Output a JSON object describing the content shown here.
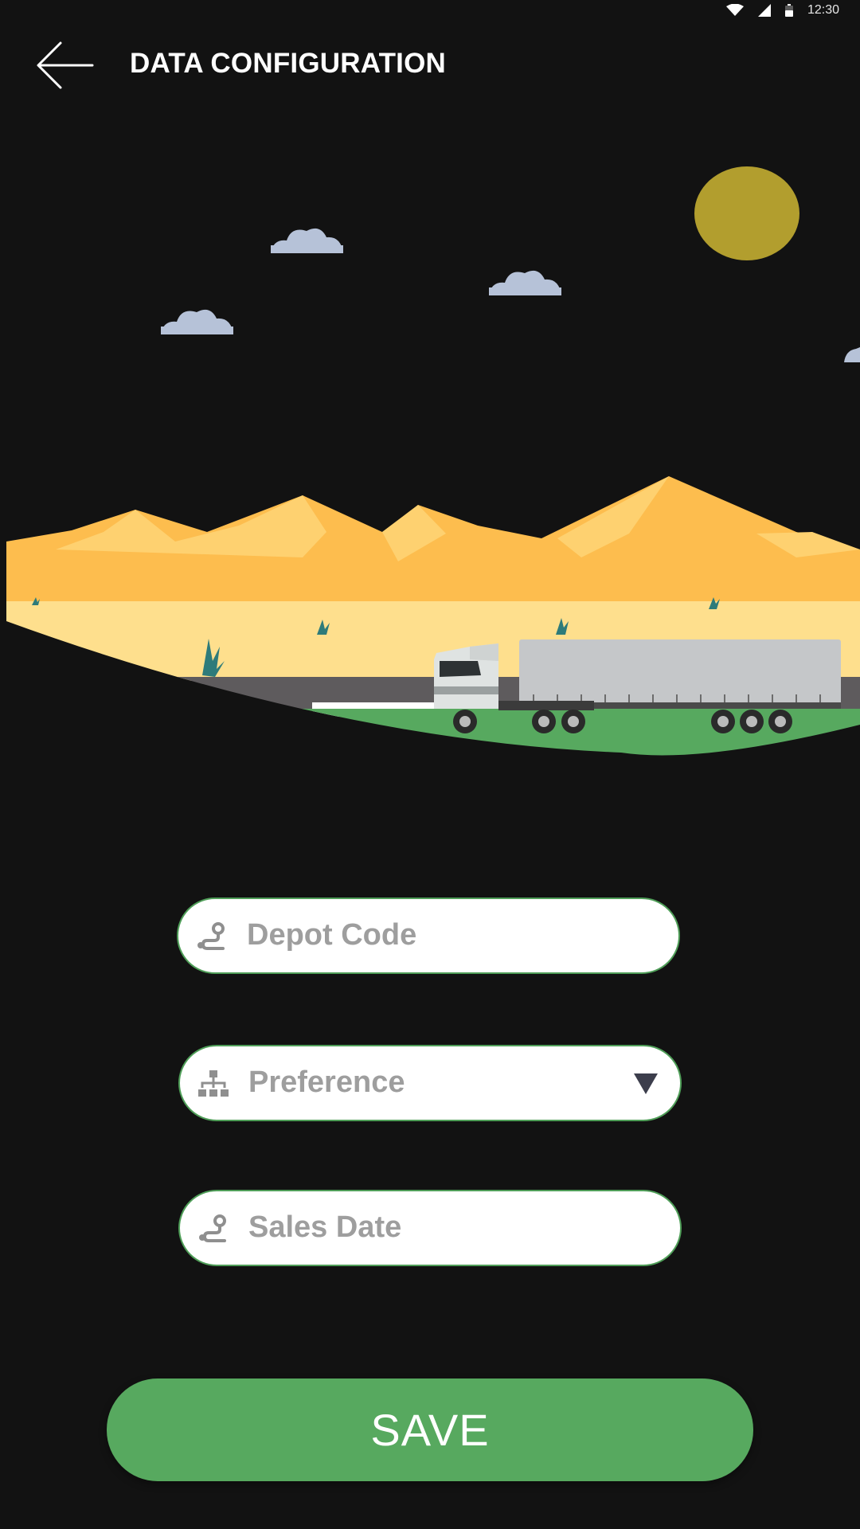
{
  "status_bar": {
    "time": "12:30",
    "icons": [
      "wifi-icon",
      "cell-signal-icon",
      "battery-icon"
    ]
  },
  "app_bar": {
    "title": "DATA CONFIGURATION",
    "back_icon": "arrow-left-icon"
  },
  "illustration": {
    "subject": "truck-in-desert-landscape"
  },
  "form": {
    "depot_code": {
      "placeholder": "Depot Code",
      "icon": "route-pin-icon"
    },
    "preference": {
      "placeholder": "Preference",
      "icon": "hierarchy-icon",
      "arrow_icon": "triangle-down-icon"
    },
    "sales_date": {
      "placeholder": "Sales Date",
      "icon": "route-pin-icon"
    }
  },
  "save_button": {
    "label": "SAVE"
  },
  "colors": {
    "background": "#121212",
    "accent_green": "#57a95f",
    "field_border": "#4f9e58",
    "placeholder_gray": "#9e9e9e",
    "sun": "#b29e2e",
    "mountain": "#fdbd4e",
    "sand": "#fedf8d"
  }
}
